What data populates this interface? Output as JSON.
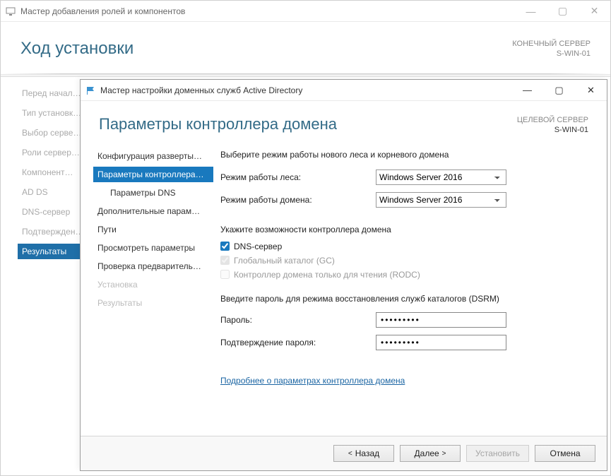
{
  "bg": {
    "title": "Мастер добавления ролей и компонентов",
    "heading": "Ход установки",
    "server_label": "КОНЕЧНЫЙ СЕРВЕР",
    "server_name": "S-WIN-01",
    "nav": [
      "Перед начал…",
      "Тип установк…",
      "Выбор серве…",
      "Роли сервер…",
      "Компонент…",
      "AD DS",
      "DNS-сервер",
      "Подтвержден…",
      "Результаты"
    ],
    "nav_selected_index": 8
  },
  "fg": {
    "title": "Мастер настройки доменных служб Active Directory",
    "heading": "Параметры контроллера домена",
    "server_label": "ЦЕЛЕВОЙ СЕРВЕР",
    "server_name": "S-WIN-01",
    "nav": [
      {
        "label": "Конфигурация разверты…",
        "sub": false,
        "selected": false,
        "disabled": false
      },
      {
        "label": "Параметры контроллера…",
        "sub": false,
        "selected": true,
        "disabled": false
      },
      {
        "label": "Параметры DNS",
        "sub": true,
        "selected": false,
        "disabled": false
      },
      {
        "label": "Дополнительные парам…",
        "sub": false,
        "selected": false,
        "disabled": false
      },
      {
        "label": "Пути",
        "sub": false,
        "selected": false,
        "disabled": false
      },
      {
        "label": "Просмотреть параметры",
        "sub": false,
        "selected": false,
        "disabled": false
      },
      {
        "label": "Проверка предваритель…",
        "sub": false,
        "selected": false,
        "disabled": false
      },
      {
        "label": "Установка",
        "sub": false,
        "selected": false,
        "disabled": true
      },
      {
        "label": "Результаты",
        "sub": false,
        "selected": false,
        "disabled": true
      }
    ],
    "section1_caption": "Выберите режим работы нового леса и корневого домена",
    "forest_label": "Режим работы леса:",
    "domain_label": "Режим работы домена:",
    "level_options": [
      "Windows Server 2016"
    ],
    "forest_value": "Windows Server 2016",
    "domain_value": "Windows Server 2016",
    "section2_caption": "Укажите возможности контроллера домена",
    "chk_dns_label": "DNS-сервер",
    "chk_dns_checked": true,
    "chk_gc_label": "Глобальный каталог (GC)",
    "chk_gc_checked": true,
    "chk_rodc_label": "Контроллер домена только для чтения (RODC)",
    "chk_rodc_checked": false,
    "section3_caption": "Введите пароль для режима восстановления служб каталогов (DSRM)",
    "pw_label": "Пароль:",
    "pw_confirm_label": "Подтверждение пароля:",
    "pw_value": "●●●●●●●●●",
    "pw_confirm_value": "●●●●●●●●●",
    "more_link": "Подробнее о параметрах контроллера домена",
    "buttons": {
      "back": "Назад",
      "next": "Далее",
      "install": "Установить",
      "cancel": "Отмена"
    }
  }
}
